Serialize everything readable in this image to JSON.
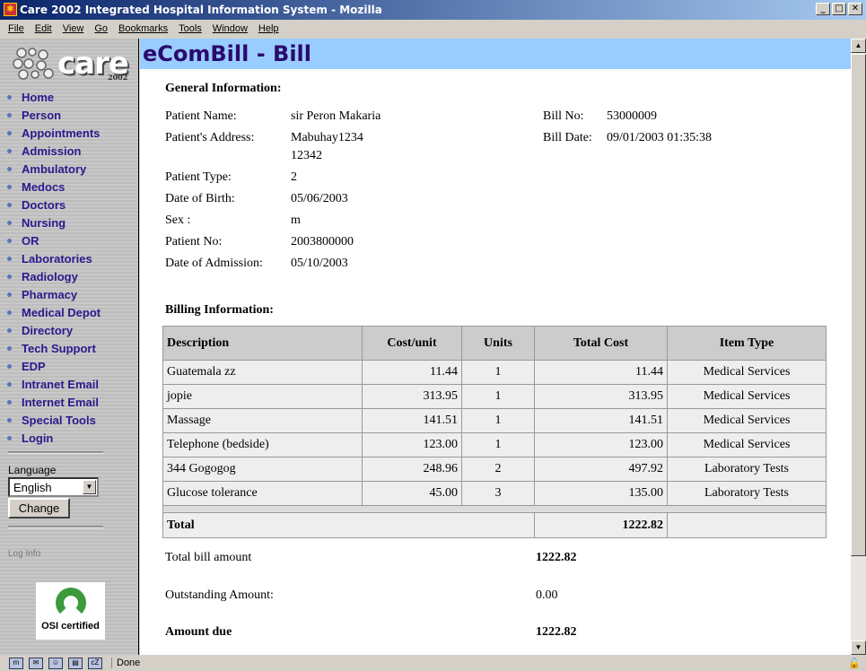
{
  "window": {
    "title": "Care 2002 Integrated Hospital Information System - Mozilla"
  },
  "menu": [
    "File",
    "Edit",
    "View",
    "Go",
    "Bookmarks",
    "Tools",
    "Window",
    "Help"
  ],
  "sidebar": {
    "logo_text": "care",
    "logo_year": "2002",
    "items": [
      "Home",
      "Person",
      "Appointments",
      "Admission",
      "Ambulatory",
      "Medocs",
      "Doctors",
      "Nursing",
      "OR",
      "Laboratories",
      "Radiology",
      "Pharmacy",
      "Medical Depot",
      "Directory",
      "Tech Support",
      "EDP",
      "Intranet Email",
      "Internet Email",
      "Special Tools",
      "Login"
    ],
    "language_label": "Language",
    "language_value": "English",
    "change_label": "Change",
    "log_info": "Log Info",
    "osi_text": "OSI certified"
  },
  "page": {
    "title": "eComBill - Bill",
    "general_heading": "General Information:",
    "fields": [
      {
        "label": "Patient Name:",
        "value": "sir Peron Makaria"
      },
      {
        "label": "Patient's Address:",
        "value": "Mabuhay1234",
        "value2": "12342"
      },
      {
        "label": "Patient Type:",
        "value": "2"
      },
      {
        "label": "Date of Birth:",
        "value": "05/06/2003"
      },
      {
        "label": "Sex :",
        "value": "m"
      },
      {
        "label": "Patient No:",
        "value": "2003800000"
      },
      {
        "label": "Date of Admission:",
        "value": "05/10/2003"
      }
    ],
    "bill_no_label": "Bill No:",
    "bill_no": "53000009",
    "bill_date_label": "Bill Date:",
    "bill_date": "09/01/2003 01:35:38",
    "billing_heading": "Billing Information:",
    "columns": [
      "Description",
      "Cost/unit",
      "Units",
      "Total Cost",
      "Item Type"
    ],
    "rows": [
      [
        "Guatemala zz",
        "11.44",
        "1",
        "11.44",
        "Medical Services"
      ],
      [
        "jopie",
        "313.95",
        "1",
        "313.95",
        "Medical Services"
      ],
      [
        "Massage",
        "141.51",
        "1",
        "141.51",
        "Medical Services"
      ],
      [
        "Telephone (bedside)",
        "123.00",
        "1",
        "123.00",
        "Medical Services"
      ],
      [
        "344 Gogogog",
        "248.96",
        "2",
        "497.92",
        "Laboratory Tests"
      ],
      [
        "Glucose tolerance",
        "45.00",
        "3",
        "135.00",
        "Laboratory Tests"
      ]
    ],
    "total_label": "Total",
    "total_value": "1222.82",
    "total_bill_label": "Total bill amount",
    "total_bill": "1222.82",
    "outstanding_label": "Outstanding Amount:",
    "outstanding": "0.00",
    "amount_due_label": "Amount due",
    "amount_due": "1222.82"
  },
  "status": {
    "text": "Done"
  }
}
